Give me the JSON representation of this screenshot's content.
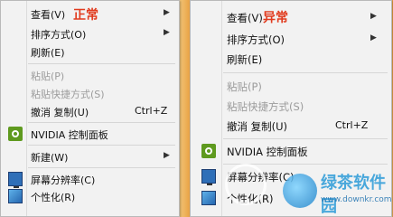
{
  "left_menu": {
    "tag": "正常",
    "items": [
      {
        "label": "查看(V)",
        "arrow": "▶"
      },
      {
        "label": "排序方式(O)",
        "arrow": "▶"
      },
      {
        "label": "刷新(E)"
      },
      {
        "label": "粘贴(P)"
      },
      {
        "label": "粘贴快捷方式(S)"
      },
      {
        "label": "撤消 复制(U)",
        "shortcut": "Ctrl+Z"
      },
      {
        "label": "NVIDIA 控制面板"
      },
      {
        "label": "新建(W)",
        "arrow": "▶"
      },
      {
        "label": "屏幕分辨率(C)"
      },
      {
        "label": "个性化(R)"
      }
    ]
  },
  "right_menu": {
    "tag": "异常",
    "items": [
      {
        "label": "查看(V)",
        "arrow": "▶"
      },
      {
        "label": "排序方式(O)",
        "arrow": "▶"
      },
      {
        "label": "刷新(E)"
      },
      {
        "label": "粘贴(P)"
      },
      {
        "label": "粘贴快捷方式(S)"
      },
      {
        "label": "撤消 复制(U)",
        "shortcut": "Ctrl+Z"
      },
      {
        "label": "NVIDIA 控制面板"
      },
      {
        "label": "屏幕分辨率(C)"
      },
      {
        "label": "个性化(R)"
      }
    ]
  },
  "watermark": {
    "name": "绿茶软件园",
    "url": "www.downkr.com"
  },
  "icons": {
    "nvidia": "nvidia-icon",
    "display": "monitor-icon",
    "personalize": "personalize-icon"
  },
  "colors": {
    "tag": "#e13b1e",
    "desktop": "#e9a44b",
    "menu_bg": "#f2f2f2"
  }
}
